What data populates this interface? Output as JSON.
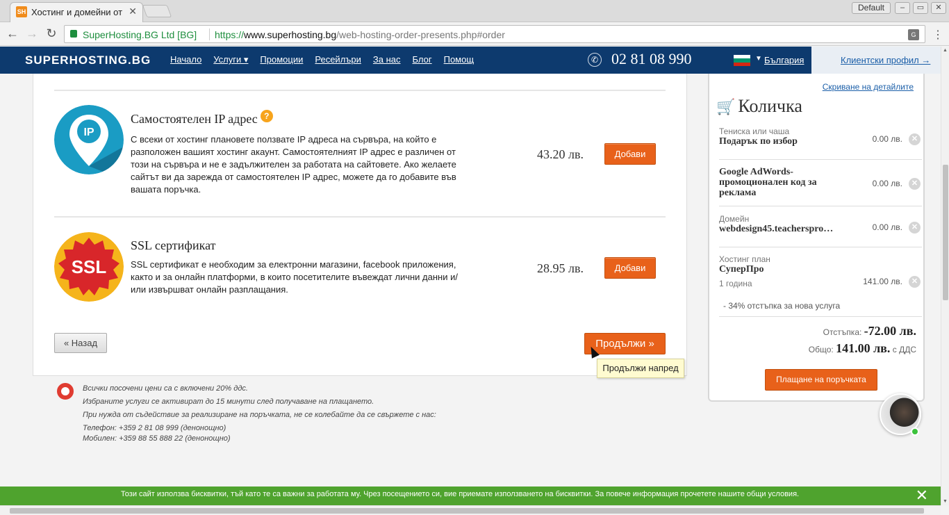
{
  "browser": {
    "tab_title": "Хостинг и домейни от",
    "tab_favicon": "SH",
    "tab_close": "✕",
    "profile": "Default",
    "secure_label": "SuperHosting.BG Ltd [BG]",
    "url_scheme": "https://",
    "url_host": "www.superhosting.bg",
    "url_path": "/web-hosting-order-presents.php#order"
  },
  "header": {
    "logo": "SUPERHOSTING.BG",
    "nav": [
      "Начало",
      "Услуги ▾",
      "Промоции",
      "Ресейлъри",
      "За нас",
      "Блог",
      "Помощ"
    ],
    "phone": "02 81 08 990",
    "language": "България",
    "client_profile": "Клиентски профил  →"
  },
  "services": [
    {
      "title": "Самостоятелен IP адрес",
      "help": "?",
      "description": "С всеки от хостинг плановете ползвате IP адреса на сървъра, на който е разположен вашият хостинг акаунт. Самостоятелният IP адрес е различен от този на сървъра и не е задължителен за работата на сайтовете. Ако желаете сайтът ви да зарежда от самостоятелен IP адрес, можете да го добавите във вашата поръчка.",
      "price": "43.20 лв.",
      "button": "Добави",
      "icon_text": "IP"
    },
    {
      "title": "SSL сертификат",
      "description": "SSL сертификат е необходим за електронни магазини, facebook приложения, както и за онлайн платформи, в които посетителите въвеждат лични данни и/или извършват онлайн разплащания.",
      "price": "28.95 лв.",
      "button": "Добави",
      "icon_text": "SSL"
    }
  ],
  "actions": {
    "back": "« Назад",
    "continue": "Продължи »",
    "tooltip": "Продължи напред"
  },
  "footnotes": [
    "Всички посочени цени са с включени 20% ддс.",
    "Избраните услуги се активират до 15 минути след получаване на плащането.",
    "При нужда от съдействие за реализиране на поръчката, не се колебайте да се свържете с нас:",
    "Телефон: +359 2 81 08 999 (денонощно)",
    "Мобилен: +359 88 55 888 22 (денонощно)"
  ],
  "cart": {
    "hide_details": "Скриване на детайлите",
    "title": "Количка",
    "items": [
      {
        "category": "Тениска или чаша",
        "name": "Подарък по избор",
        "price": "0.00 лв."
      },
      {
        "category": "",
        "name": "Google AdWords-промоционален код за реклама",
        "price": "0.00 лв."
      },
      {
        "category": "Домейн",
        "name": "webdesign45.teacherspro…",
        "price": "0.00 лв."
      },
      {
        "category": "Хостинг план",
        "name": "СуперПро",
        "sub": "1 година",
        "price": "141.00 лв.",
        "note": "- 34% отстъпка за нова услуга"
      }
    ],
    "discount_label": "Отстъпка:",
    "discount_value": "-72.00 лв.",
    "total_label": "Общо:",
    "total_value": "141.00 лв.",
    "vat_note": "с ДДС",
    "pay_button": "Плащане на поръчката"
  },
  "cookie": {
    "text": "Този сайт използва бисквитки, тъй като те са важни за работата му. Чрез посещението си, вие приемате използването на бисквитки. За повече информация прочетете нашите общи условия.",
    "close": "✕"
  },
  "colors": {
    "header_bg": "#0d3a6e",
    "accent_orange": "#e8611a",
    "cookie_green": "#4fa32e",
    "link_blue": "#1a5ea8"
  }
}
